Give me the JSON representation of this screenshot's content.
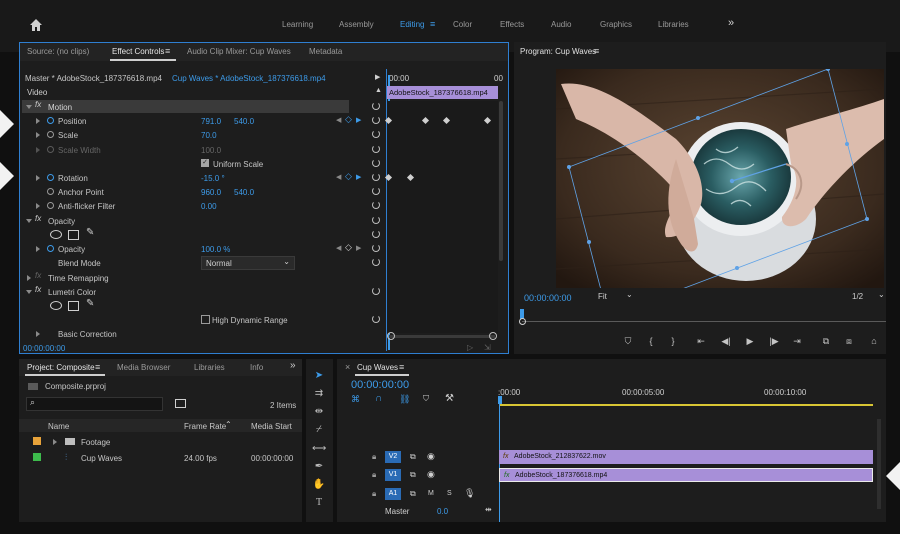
{
  "top_nav": {
    "items": [
      "Learning",
      "Assembly",
      "Editing",
      "Color",
      "Effects",
      "Audio",
      "Graphics",
      "Libraries"
    ],
    "active": "Editing",
    "more": "»"
  },
  "source_panel": {
    "tabs": [
      "Source: (no clips)",
      "Effect Controls",
      "Audio Clip Mixer: Cup Waves",
      "Metadata"
    ],
    "master_label": "Master * AdobeStock_187376618.mp4",
    "seq_label": "Cup Waves * AdobeStock_187376618.mp4",
    "timecode_ruler": "00:00",
    "ruler_end": "00",
    "clip_label": "AdobeStock_187376618.mp4",
    "video_header": "Video",
    "motion": {
      "label": "Motion",
      "position": {
        "label": "Position",
        "x": "791.0",
        "y": "540.0"
      },
      "scale": {
        "label": "Scale",
        "value": "70.0"
      },
      "scale_width": {
        "label": "Scale Width",
        "value": "100.0"
      },
      "uniform_scale": "Uniform Scale",
      "rotation": {
        "label": "Rotation",
        "value": "-15.0 °"
      },
      "anchor": {
        "label": "Anchor Point",
        "x": "960.0",
        "y": "540.0"
      },
      "flicker": {
        "label": "Anti-flicker Filter",
        "value": "0.00"
      }
    },
    "opacity_group": {
      "label": "Opacity",
      "opacity": {
        "label": "Opacity",
        "value": "100.0 %"
      },
      "blend": {
        "label": "Blend Mode",
        "value": "Normal"
      }
    },
    "time_remap": "Time Remapping",
    "lumetri": {
      "label": "Lumetri Color",
      "hdr": "High Dynamic Range",
      "basic": "Basic Correction"
    },
    "footer_tc": "00:00:00:00",
    "keyframe_zero": "0"
  },
  "program": {
    "title": "Program: Cup Waves",
    "timecode": "00:00:00:00",
    "fit": "Fit",
    "ratio": "1/2"
  },
  "project": {
    "tabs": [
      "Project: Composite",
      "Media Browser",
      "Libraries",
      "Info"
    ],
    "file": "Composite.prproj",
    "items_count": "2 Items",
    "columns": [
      "Name",
      "Frame Rate",
      "Media Start"
    ],
    "rows": [
      {
        "name": "Footage",
        "rate": "",
        "start": "",
        "color": "#e8a33a"
      },
      {
        "name": "Cup Waves",
        "rate": "24.00 fps",
        "start": "00:00:00:00",
        "color": "#3dbb4c"
      }
    ]
  },
  "timeline": {
    "title": "Cup Waves",
    "timecode": "00:00:00:00",
    "ruler": [
      ":00:00",
      "00:00:05:00",
      "00:00:10:00"
    ],
    "tracks": [
      {
        "label": "V2",
        "clip": "AdobeStock_212837622.mov"
      },
      {
        "label": "V1",
        "clip": "AdobeStock_187376618.mp4"
      },
      {
        "label": "A1"
      }
    ],
    "master": {
      "label": "Master",
      "value": "0.0"
    },
    "track_buttons": {
      "mute": "M",
      "solo": "S"
    }
  },
  "colors": {
    "accent": "#3d9be9",
    "clip": "#a78fd8",
    "panel": "#1d1d1d"
  }
}
